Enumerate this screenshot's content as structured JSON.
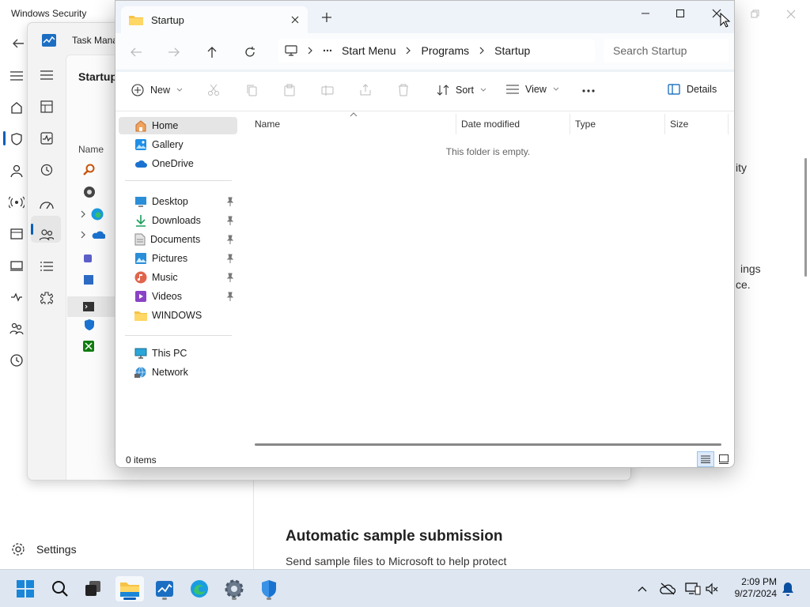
{
  "windows_security": {
    "title": "Windows Security",
    "settings_label": "Settings",
    "right_text_1": "ity",
    "right_text_2": "ings",
    "right_text_3": "ce.",
    "section_title": "Automatic sample submission",
    "section_desc": "Send sample files to Microsoft to help protect"
  },
  "task_manager": {
    "title": "Task Mana",
    "page_title": "Startup",
    "column_name": "Name"
  },
  "explorer": {
    "tab_title": "Startup",
    "breadcrumb": [
      "Start Menu",
      "Programs",
      "Startup"
    ],
    "search_placeholder": "Search Startup",
    "toolbar": {
      "new": "New",
      "sort": "Sort",
      "view": "View",
      "details": "Details"
    },
    "nav": {
      "home": "Home",
      "gallery": "Gallery",
      "onedrive": "OneDrive",
      "desktop": "Desktop",
      "downloads": "Downloads",
      "documents": "Documents",
      "pictures": "Pictures",
      "music": "Music",
      "videos": "Videos",
      "windows": "WINDOWS",
      "thispc": "This PC",
      "network": "Network"
    },
    "columns": {
      "name": "Name",
      "date": "Date modified",
      "type": "Type",
      "size": "Size"
    },
    "empty_message": "This folder is empty.",
    "item_count": "0 items"
  },
  "taskbar": {
    "time": "2:09 PM",
    "date": "9/27/2024"
  },
  "colors": {
    "accent": "#005fb8",
    "taskbar": "#dde6f1",
    "folder": "#f6c344"
  }
}
